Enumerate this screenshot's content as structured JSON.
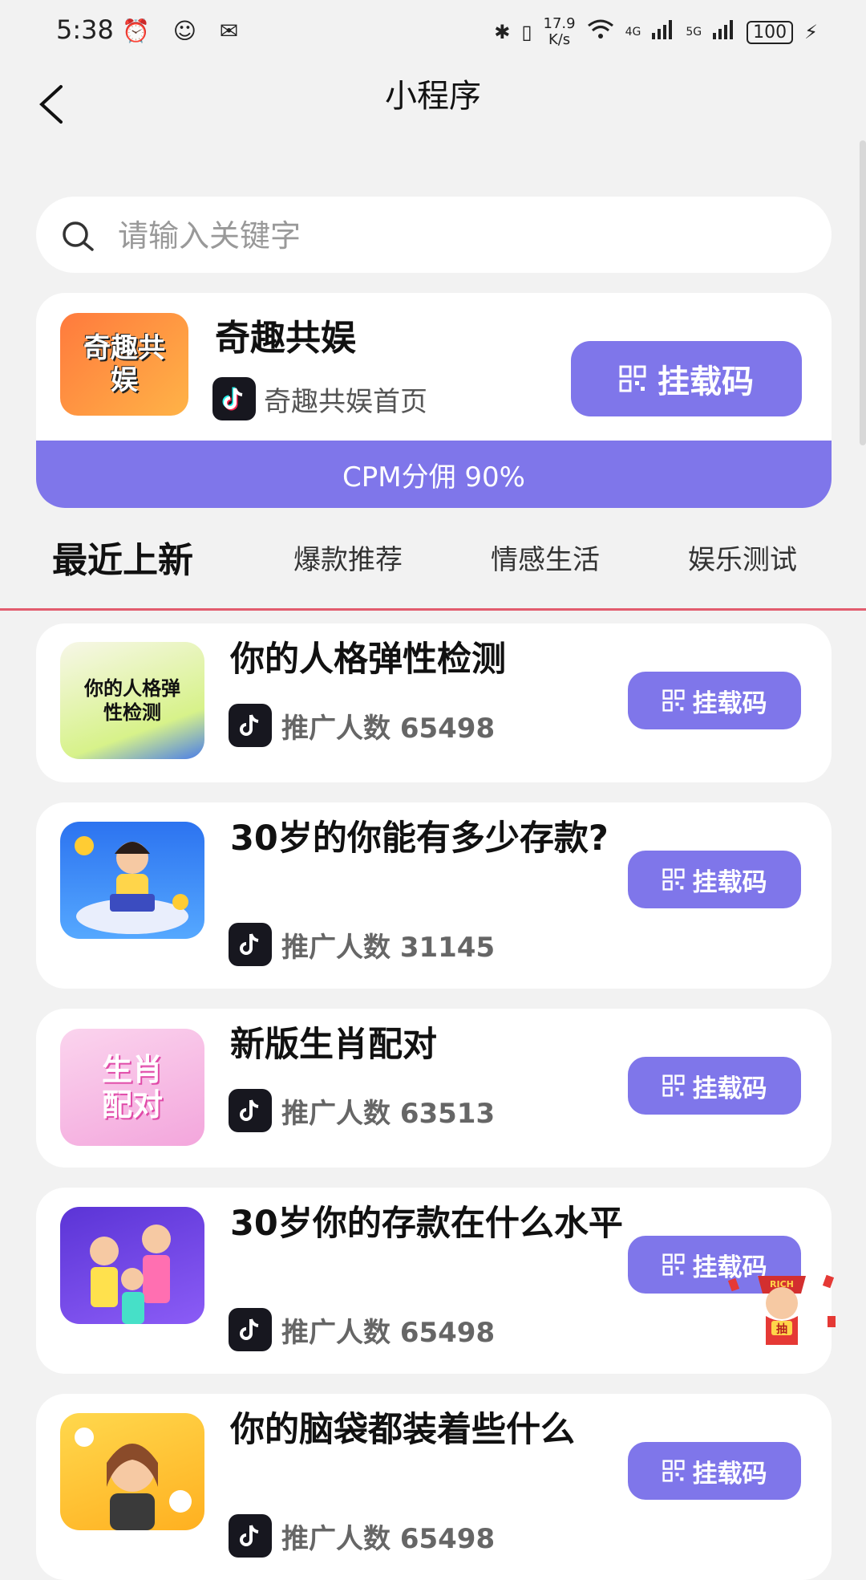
{
  "status_bar": {
    "time": "5:38",
    "speed_value": "17.9",
    "speed_unit": "K/s",
    "net1": "4G",
    "net2": "5G",
    "battery": "100"
  },
  "header": {
    "title": "小程序"
  },
  "search": {
    "placeholder": "请输入关键字",
    "value": ""
  },
  "featured": {
    "logo_text": "奇趣共娱",
    "title": "奇趣共娱",
    "subtitle": "奇趣共娱首页",
    "button_label": "挂载码",
    "banner": "CPM分佣 90%"
  },
  "tabs": [
    {
      "label": "最近上新",
      "active": true
    },
    {
      "label": "爆款推荐",
      "active": false
    },
    {
      "label": "情感生活",
      "active": false
    },
    {
      "label": "娱乐测试",
      "active": false
    }
  ],
  "items": [
    {
      "thumb_text": "你的人格弹性检测",
      "title": "你的人格弹性检测",
      "stat": "推广人数 65498",
      "button": "挂载码"
    },
    {
      "thumb_text": "",
      "title": "30岁的你能有多少存款?",
      "stat": "推广人数 31145",
      "button": "挂载码"
    },
    {
      "thumb_text": "生肖配对",
      "title": "新版生肖配对",
      "stat": "推广人数 63513",
      "button": "挂载码"
    },
    {
      "thumb_text": "",
      "title": "30岁你的存款在什么水平",
      "stat": "推广人数 65498",
      "button": "挂载码"
    },
    {
      "thumb_text": "",
      "title": "你的脑袋都装着些什么",
      "stat": "推广人数 65498",
      "button": "挂载码"
    }
  ],
  "floating": {
    "mascot_text": "RICH",
    "mascot_sub": "抽"
  },
  "colors": {
    "accent": "#7f76ea",
    "tab_underline": "#e25c6e",
    "background": "#f2f2f2"
  }
}
